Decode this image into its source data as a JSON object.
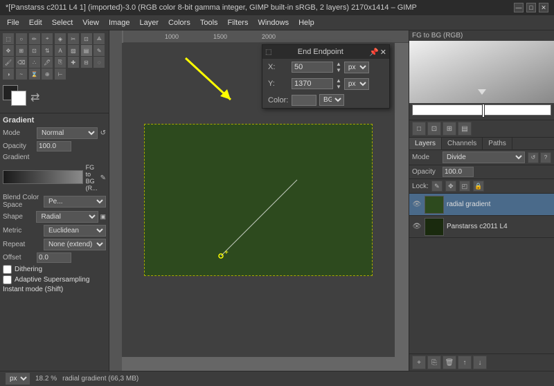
{
  "title_bar": {
    "title": "*[Panstarss c2011 L4 1] (imported)-3.0 (RGB color 8-bit gamma integer, GIMP built-in sRGB, 2 layers) 2170x1414 – GIMP",
    "minimize": "—",
    "maximize": "□",
    "close": "✕"
  },
  "menu": {
    "items": [
      "File",
      "Edit",
      "Select",
      "View",
      "Image",
      "Layer",
      "Colors",
      "Tools",
      "Filters",
      "Windows",
      "Help"
    ]
  },
  "toolbox": {
    "gradient_label": "Gradient",
    "mode_label": "Mode",
    "mode_value": "Normal",
    "opacity_label": "Opacity",
    "opacity_value": "100.0",
    "gradient_name": "FG to BG (R...",
    "blend_color_space_label": "Blend Color Space Pe...",
    "shape_label": "Shape",
    "shape_value": "Radial",
    "metric_label": "Metric",
    "metric_value": "Euclidean",
    "repeat_label": "Repeat",
    "repeat_value": "None (extend)",
    "offset_label": "Offset",
    "offset_value": "0.0",
    "dithering_label": "Dithering",
    "adaptive_label": "Adaptive Supersampling",
    "instant_label": "Instant mode (Shift)"
  },
  "endpoint_dialog": {
    "title": "End Endpoint",
    "x_label": "X:",
    "x_value": "50",
    "y_label": "Y:",
    "y_value": "1370",
    "unit": "px",
    "color_label": "Color:",
    "bg_value": "BG"
  },
  "right_panel": {
    "color_title": "FG to BG (RGB)",
    "tabs": [
      "Layers",
      "Channels",
      "Paths"
    ],
    "active_tab": "Layers",
    "mode_label": "Mode",
    "mode_value": "Divide",
    "opacity_label": "Opacity",
    "opacity_value": "100.0",
    "lock_label": "Lock:",
    "layers": [
      {
        "name": "radial gradient",
        "visible": true,
        "active": true
      },
      {
        "name": "Panstarss c2011 L4",
        "visible": true,
        "active": false
      }
    ]
  },
  "status_bar": {
    "unit": "px",
    "zoom": "18.2 %",
    "layer": "radial gradient (66,3 MB)"
  },
  "canvas": {
    "ruler_marks": [
      "1000",
      "1500",
      "2000"
    ]
  }
}
